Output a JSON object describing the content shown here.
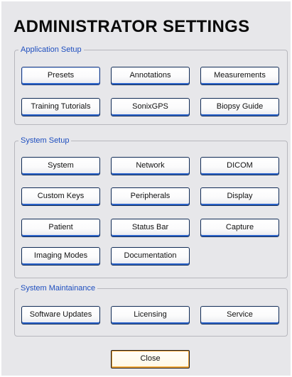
{
  "title": "ADMINISTRATOR SETTINGS",
  "sections": {
    "application_setup": {
      "legend": "Application Setup",
      "buttons": [
        "Presets",
        "Annotations",
        "Measurements",
        "Training Tutorials",
        "SonixGPS",
        "Biopsy Guide"
      ]
    },
    "system_setup": {
      "legend": "System Setup",
      "buttons": [
        "System",
        "Network",
        "DICOM",
        "Custom Keys",
        "Peripherals",
        "Display",
        "Patient",
        "Status Bar",
        "Capture",
        "Imaging Modes",
        "Documentation"
      ]
    },
    "system_maintenance": {
      "legend": "System Maintainance",
      "buttons": [
        "Software Updates",
        "Licensing",
        "Service"
      ]
    }
  },
  "close_label": "Close",
  "colors": {
    "panel_bg": "#e7e7ea",
    "legend_text": "#1f4fbf",
    "button_accent": "#2c63c9",
    "close_accent": "#f0a030"
  }
}
